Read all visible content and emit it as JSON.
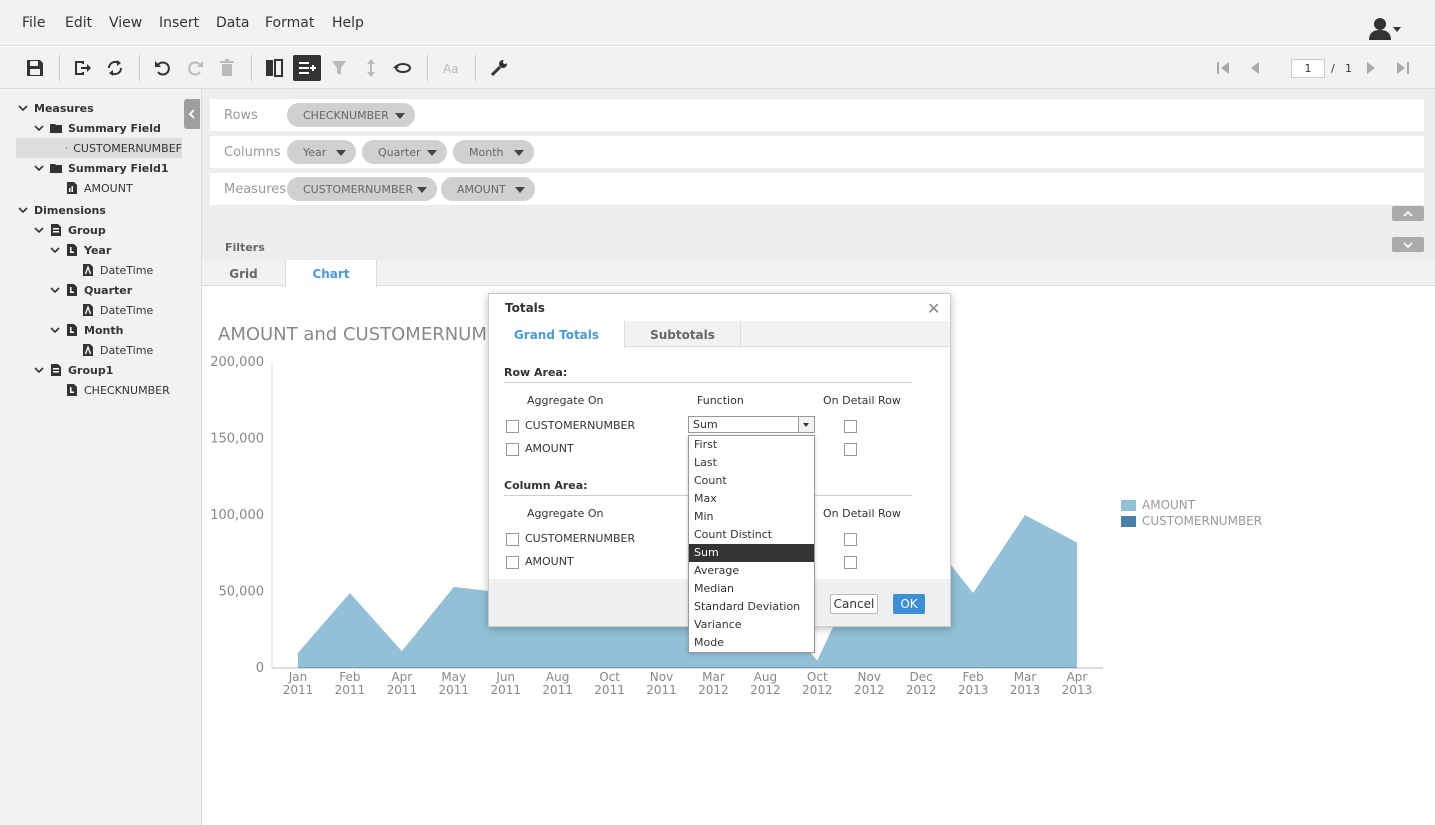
{
  "menu": {
    "items": [
      "File",
      "Edit",
      "View",
      "Insert",
      "Data",
      "Format",
      "Help"
    ]
  },
  "toolbar": {
    "icons": [
      "save-icon",
      "export-icon",
      "refresh-icon",
      "undo-icon",
      "redo-icon",
      "delete-icon",
      "layout-icon",
      "add-totals-icon",
      "filter-icon",
      "sort-icon",
      "swap-axes-icon",
      "text-format-icon",
      "settings-icon"
    ]
  },
  "pager": {
    "current": "1",
    "separator": "/",
    "total": "1"
  },
  "tree": {
    "measures_label": "Measures",
    "summary_field": "Summary Field",
    "customernumber": "CUSTOMERNUMBEF",
    "summary_field1": "Summary Field1",
    "amount": "AMOUNT",
    "dimensions_label": "Dimensions",
    "group": "Group",
    "year": "Year",
    "year_datetime": "DateTime",
    "quarter": "Quarter",
    "quarter_datetime": "DateTime",
    "month": "Month",
    "month_datetime": "DateTime",
    "group1": "Group1",
    "checknumber": "CHECKNUMBER"
  },
  "drop": {
    "rows_label": "Rows",
    "rows": [
      "CHECKNUMBER"
    ],
    "columns_label": "Columns",
    "columns": [
      "Year",
      "Quarter",
      "Month"
    ],
    "measures_label": "Measures",
    "measures": [
      "CUSTOMERNUMBER",
      "AMOUNT"
    ],
    "filters_label": "Filters"
  },
  "tabs": {
    "grid": "Grid",
    "chart": "Chart"
  },
  "chart_data": {
    "type": "area",
    "title": "AMOUNT and CUSTOMERNUMBE",
    "categories": [
      "Jan 2011",
      "Feb 2011",
      "Apr 2011",
      "May 2011",
      "Jun 2011",
      "Aug 2011",
      "Oct 2011",
      "Nov 2011",
      "Mar 2012",
      "Aug 2012",
      "Oct 2012",
      "Nov 2012",
      "Dec 2012",
      "Feb 2013",
      "Mar 2013",
      "Apr 2013"
    ],
    "x_ticks": [
      [
        "Jan",
        "2011"
      ],
      [
        "Feb",
        "2011"
      ],
      [
        "Apr",
        "2011"
      ],
      [
        "May",
        "2011"
      ],
      [
        "Jun",
        "2011"
      ],
      [
        "Aug",
        "2011"
      ],
      [
        "Oct",
        "2011"
      ],
      [
        "Nov",
        "2011"
      ],
      [
        "Mar",
        "2012"
      ],
      [
        "Aug",
        "2012"
      ],
      [
        "Oct",
        "2012"
      ],
      [
        "Nov",
        "2012"
      ],
      [
        "Dec",
        "2012"
      ],
      [
        "Feb",
        "2013"
      ],
      [
        "Mar",
        "2013"
      ],
      [
        "Apr",
        "2013"
      ]
    ],
    "y_ticks": [
      "0",
      "50,000",
      "100,000",
      "150,000",
      "200,000"
    ],
    "ylim": [
      0,
      200000
    ],
    "series": [
      {
        "name": "AMOUNT",
        "color": "#92c0d6",
        "values": [
          10000,
          49000,
          11000,
          53000,
          49000,
          46000,
          50000,
          43000,
          38000,
          41000,
          5000,
          77000,
          92000,
          49000,
          100000,
          82000
        ]
      },
      {
        "name": "CUSTOMERNUMBER",
        "color": "#4a7faa",
        "values": [
          300,
          300,
          300,
          300,
          300,
          300,
          300,
          300,
          300,
          300,
          300,
          300,
          300,
          300,
          300,
          300
        ]
      }
    ],
    "legend_position": "right"
  },
  "dialog": {
    "title": "Totals",
    "tab_grand": "Grand Totals",
    "tab_sub": "Subtotals",
    "row_area": "Row Area:",
    "column_area": "Column Area:",
    "aggregate_on": "Aggregate On",
    "function": "Function",
    "on_detail_row": "On Detail Row",
    "row_items": [
      "CUSTOMERNUMBER",
      "AMOUNT"
    ],
    "col_items": [
      "CUSTOMERNUMBER",
      "AMOUNT"
    ],
    "selected_function": "Sum",
    "functions": [
      "First",
      "Last",
      "Count",
      "Max",
      "Min",
      "Count Distinct",
      "Sum",
      "Average",
      "Median",
      "Standard Deviation",
      "Variance",
      "Mode"
    ],
    "cancel": "Cancel",
    "ok": "OK"
  }
}
